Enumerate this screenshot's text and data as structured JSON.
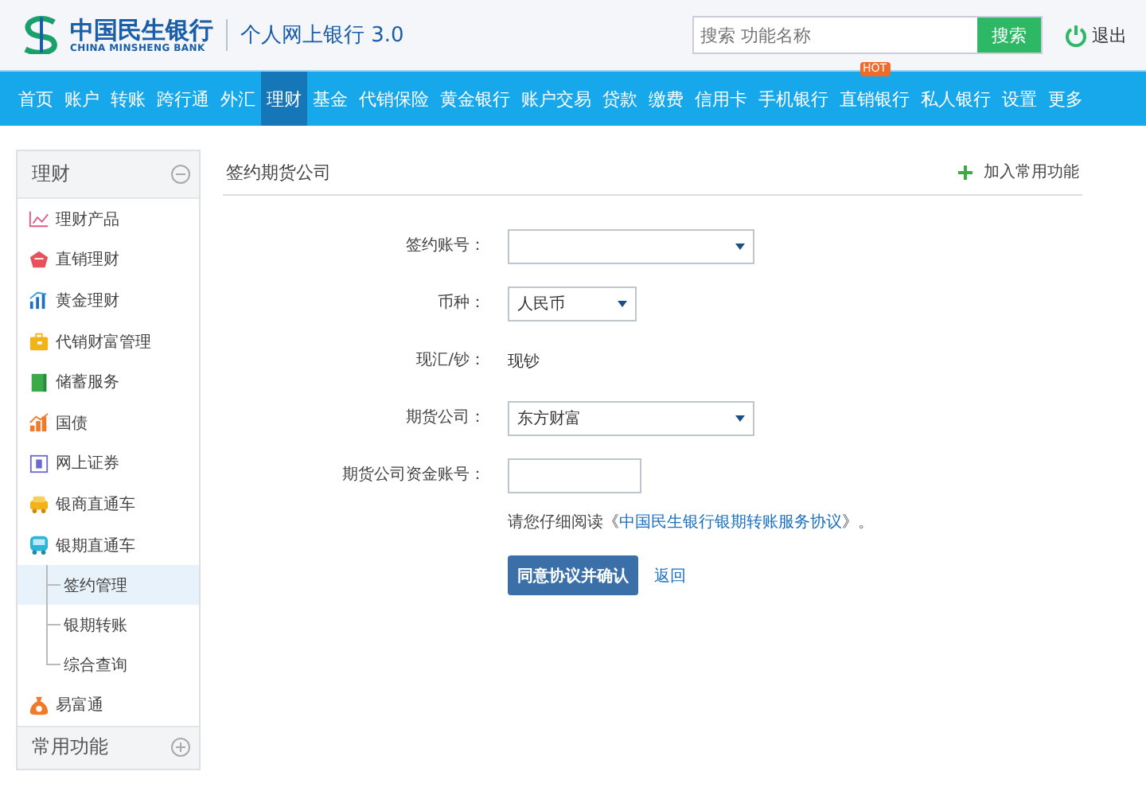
{
  "header": {
    "logo": {
      "name": "中国民生银行",
      "english": "CHINA MINSHENG BANK"
    },
    "product": "个人网上银行 3.0",
    "search": {
      "placeholder": "搜索 功能名称",
      "button": "搜索"
    },
    "logout": "退出"
  },
  "nav": [
    {
      "label": "首页",
      "selected": false
    },
    {
      "label": "账户",
      "selected": false
    },
    {
      "label": "转账",
      "selected": false
    },
    {
      "label": "跨行通",
      "selected": false
    },
    {
      "label": "外汇",
      "selected": false
    },
    {
      "label": "理财",
      "selected": true
    },
    {
      "label": "基金",
      "selected": false
    },
    {
      "label": "代销保险",
      "selected": false
    },
    {
      "label": "黄金银行",
      "selected": false
    },
    {
      "label": "账户交易",
      "selected": false
    },
    {
      "label": "贷款",
      "selected": false
    },
    {
      "label": "缴费",
      "selected": false
    },
    {
      "label": "信用卡",
      "selected": false
    },
    {
      "label": "手机银行",
      "selected": false
    },
    {
      "label": "直销银行",
      "selected": false,
      "badge": "HOT"
    },
    {
      "label": "私人银行",
      "selected": false
    },
    {
      "label": "设置",
      "selected": false
    },
    {
      "label": "更多",
      "selected": false
    }
  ],
  "sidebar": {
    "sections": [
      {
        "title": "理财",
        "expanded": true,
        "items": [
          {
            "label": "理财产品",
            "kind": "line-chart"
          },
          {
            "label": "直销理财",
            "kind": "gem"
          },
          {
            "label": "黄金理财",
            "kind": "bars"
          },
          {
            "label": "代销财富管理",
            "kind": "briefcase"
          },
          {
            "label": "储蓄服务",
            "kind": "book"
          },
          {
            "label": "国债",
            "kind": "rising-bars"
          },
          {
            "label": "网上证券",
            "kind": "screen"
          },
          {
            "label": "银商直通车",
            "kind": "car"
          },
          {
            "label": "银期直通车",
            "kind": "bus",
            "children": [
              {
                "label": "签约管理",
                "selected": true
              },
              {
                "label": "银期转账",
                "selected": false
              },
              {
                "label": "综合查询",
                "selected": false
              }
            ]
          },
          {
            "label": "易富通",
            "kind": "money-bag"
          }
        ]
      },
      {
        "title": "常用功能",
        "expanded": false
      }
    ]
  },
  "main": {
    "title": "签约期货公司",
    "add_favorite": "加入常用功能",
    "fields": [
      {
        "label": "签约账号：",
        "kind": "select"
      },
      {
        "label": "币种：",
        "kind": "select-small",
        "value": "人民币"
      },
      {
        "label": "现汇/钞：",
        "kind": "static",
        "value": "现钞"
      },
      {
        "label": "期货公司：",
        "kind": "select",
        "value": "东方财富"
      },
      {
        "label": "期货公司资金账号：",
        "kind": "input"
      }
    ],
    "notice": {
      "before": "请您仔细阅读《",
      "link": "中国民生银行银期转账服务协议",
      "after": "》。"
    },
    "confirm": "同意协议并确认",
    "back": "返回"
  }
}
